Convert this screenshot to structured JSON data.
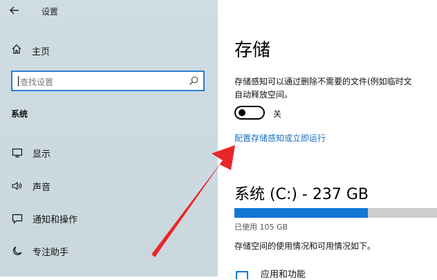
{
  "window": {
    "title": "设置"
  },
  "sidebar": {
    "home_label": "主页",
    "search_placeholder": "查找设置",
    "section_title": "系统",
    "items": [
      {
        "label": "显示",
        "icon": "monitor-icon"
      },
      {
        "label": "声音",
        "icon": "speaker-icon"
      },
      {
        "label": "通知和操作",
        "icon": "notification-icon"
      },
      {
        "label": "专注助手",
        "icon": "moon-icon"
      }
    ]
  },
  "main": {
    "title": "存储",
    "description": "存储感知可以通过删除不需要的文件(例如临时文\n自动释放空间。",
    "toggle_label": "关",
    "toggle_state": "off",
    "link": "配置存储感知或立即运行",
    "drive_title": "系统 (C:) - 237 GB",
    "used_label": "已使用 105 GB",
    "used_fraction": 0.66,
    "info": "存储空间的使用情况和可用情况如下。",
    "category": "应用和功能"
  },
  "colors": {
    "accent": "#1177d4",
    "link": "#1a6fc2",
    "annotation_arrow": "#e8262a"
  }
}
